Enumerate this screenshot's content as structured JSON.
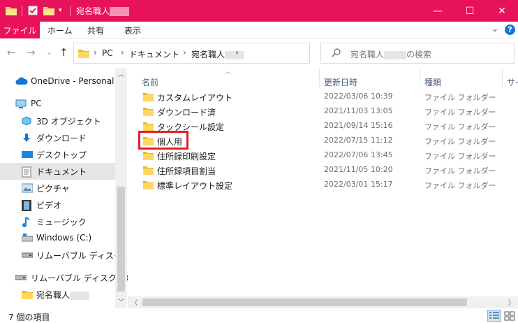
{
  "window": {
    "title_prefix": "宛名職人",
    "minimize_glyph": "—",
    "maximize_glyph": "☐",
    "close_glyph": "✕",
    "accent_color": "#e8115b"
  },
  "ribbon": {
    "tabs": [
      "ファイル",
      "ホーム",
      "共有",
      "表示"
    ],
    "expand_glyph": "⌄",
    "help_glyph": "?"
  },
  "nav": {
    "back_glyph": "←",
    "forward_glyph": "→",
    "recent_glyph": "⌄",
    "up_glyph": "↑",
    "breadcrumb": [
      "PC",
      "ドキュメント",
      "宛名職人"
    ],
    "crumb_sep": "›",
    "dropdown_glyph": "⌄",
    "refresh_glyph": "↻",
    "search_prefix": "宛名職人",
    "search_suffix": "の検索",
    "search_icon": "search-icon"
  },
  "sidebar": {
    "items": [
      {
        "label": "OneDrive - Personal",
        "icon": "cloud-icon"
      },
      {
        "label": "PC",
        "icon": "pc-icon"
      },
      {
        "label": "3D オブジェクト",
        "icon": "cube-icon"
      },
      {
        "label": "ダウンロード",
        "icon": "download-icon"
      },
      {
        "label": "デスクトップ",
        "icon": "desktop-icon"
      },
      {
        "label": "ドキュメント",
        "icon": "documents-icon"
      },
      {
        "label": "ピクチャ",
        "icon": "pictures-icon"
      },
      {
        "label": "ビデオ",
        "icon": "video-icon"
      },
      {
        "label": "ミュージック",
        "icon": "music-icon"
      },
      {
        "label": "Windows (C:)",
        "icon": "drive-icon"
      },
      {
        "label": "リムーバブル ディスク (D:)",
        "icon": "usb-drive-icon"
      },
      {
        "label": "リムーバブル ディスク (D:)",
        "icon": "usb-drive-icon"
      },
      {
        "label": "宛名職人",
        "icon": "folder-icon"
      }
    ]
  },
  "columns": {
    "name": "名前",
    "modified": "更新日時",
    "type": "種類",
    "size": "サイ"
  },
  "files": [
    {
      "name": "カスタムレイアウト",
      "modified": "2022/03/06 10:39",
      "type": "ファイル フォルダー"
    },
    {
      "name": "ダウンロード済",
      "modified": "2021/11/03 13:05",
      "type": "ファイル フォルダー"
    },
    {
      "name": "タックシール設定",
      "modified": "2021/09/14 15:16",
      "type": "ファイル フォルダー"
    },
    {
      "name": "個人用",
      "modified": "2022/07/15 11:12",
      "type": "ファイル フォルダー"
    },
    {
      "name": "住所録印刷設定",
      "modified": "2022/07/06 13:45",
      "type": "ファイル フォルダー"
    },
    {
      "name": "住所録項目割当",
      "modified": "2021/11/05 10:20",
      "type": "ファイル フォルダー"
    },
    {
      "name": "標準レイアウト設定",
      "modified": "2022/03/01 15:17",
      "type": "ファイル フォルダー"
    }
  ],
  "status": {
    "item_count": "7 個の項目"
  },
  "colors": {
    "folder": "#ffd75e",
    "highlight_box": "#e21f26",
    "selected_nav": "#e5e5e5"
  }
}
